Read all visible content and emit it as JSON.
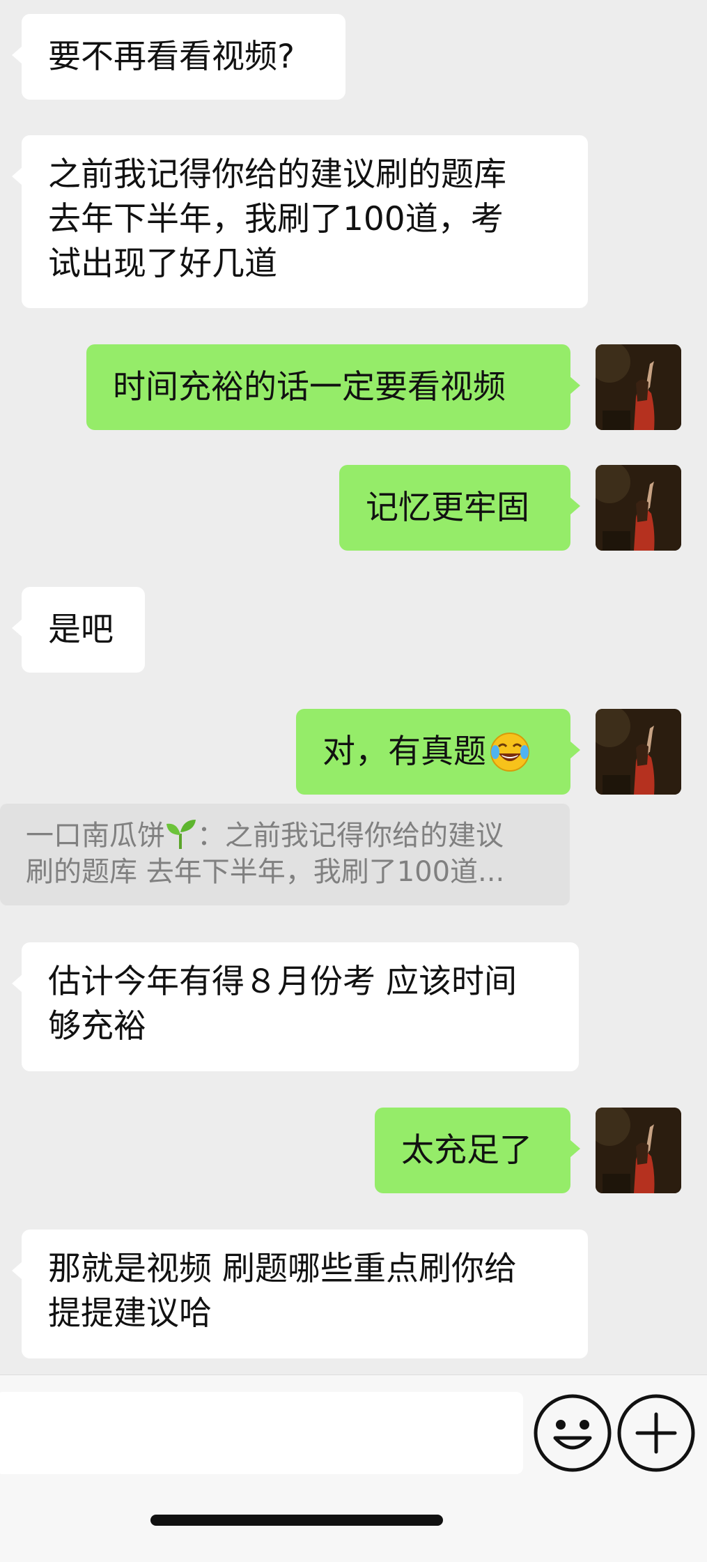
{
  "messages": [
    {
      "side": "in",
      "text": "要不再看看视频?"
    },
    {
      "side": "in",
      "text": "之前我记得你给的建议刷的题库\n去年下半年，我刷了100道，考\n试出现了好几道"
    },
    {
      "side": "out",
      "text": "时间充裕的话一定要看视频"
    },
    {
      "side": "out",
      "text": "记忆更牢固"
    },
    {
      "side": "in",
      "text": "是吧"
    },
    {
      "side": "out",
      "text": "对，有真题",
      "emoji": "laughing-tears-emoji"
    },
    {
      "side": "in",
      "text": "估计今年有得８月份考 应该时间\n够充裕"
    },
    {
      "side": "out",
      "text": "太充足了"
    },
    {
      "side": "in",
      "text": "那就是视频 刷题哪些重点刷你给\n提提建议哈"
    }
  ],
  "quote": {
    "author": "一口南瓜饼",
    "author_icon": "seedling-icon",
    "separator": "：",
    "line1": "之前我记得你给的建议",
    "line2": "刷的题库 去年下半年，我刷了100道..."
  },
  "input_bar": {
    "emoji_icon": "smiley-face-icon",
    "more_icon": "plus-circle-icon"
  },
  "colors": {
    "background": "#ededed",
    "incoming_bubble": "#ffffff",
    "outgoing_bubble": "#95ec69",
    "quote_bg": "#e1e1e1",
    "quote_text": "#808080"
  }
}
